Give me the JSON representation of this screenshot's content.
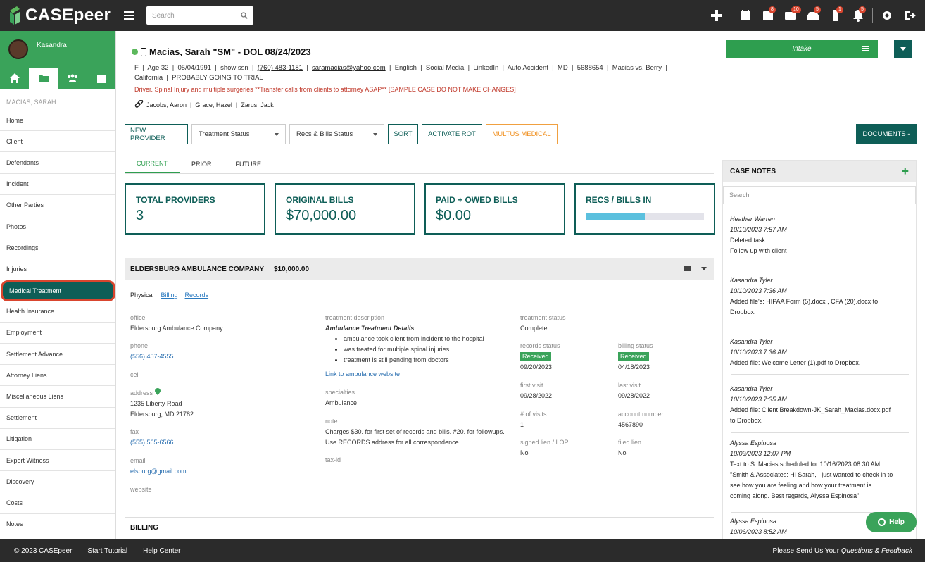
{
  "app": {
    "name": "CASEpeer",
    "brand_color": "#2e9e4f",
    "dark_color": "#0e5e57"
  },
  "header": {
    "search_placeholder": "Search",
    "badges": {
      "tasks": "8",
      "mail": "10",
      "inbox": "5",
      "phone": "1",
      "alerts": "5"
    }
  },
  "user": {
    "name": "Kasandra"
  },
  "sidebar": {
    "case_label": "MACIAS, SARAH",
    "items": [
      "Home",
      "Client",
      "Defendants",
      "Incident",
      "Other Parties",
      "Photos",
      "Recordings",
      "Injuries",
      "Medical Treatment",
      "Health Insurance",
      "Employment",
      "Settlement Advance",
      "Attorney Liens",
      "Miscellaneous Liens",
      "Settlement",
      "Litigation",
      "Expert Witness",
      "Discovery",
      "Costs",
      "Notes"
    ],
    "active": "Medical Treatment"
  },
  "case": {
    "title": "Macias, Sarah \"SM\" - DOL 08/24/2023",
    "line1": [
      "F",
      "Age 32",
      "05/04/1991",
      "show ssn"
    ],
    "phone": "(760) 483-1181",
    "email": "saramacias@yahoo.com",
    "line1b": [
      "English",
      "Social Media",
      "LinkedIn",
      "Auto Accident",
      "MD",
      "5688654",
      "Macias vs. Berry"
    ],
    "line2": [
      "California",
      "PROBABLY GOING TO TRIAL"
    ],
    "alert": "Driver. Spinal Injury and multiple surgeries **Transfer calls from clients to attorney ASAP** [SAMPLE CASE DO NOT MAKE CHANGES]",
    "contacts": [
      "Jacobs, Aaron",
      "Grace, Hazel",
      "Zarus, Jack"
    ],
    "stage": "Intake"
  },
  "toolbar": {
    "new_provider": "NEW PROVIDER",
    "treatment_status": "Treatment Status",
    "recs_bills_status": "Recs & Bills Status",
    "sort": "SORT",
    "activate_rot": "ACTIVATE ROT",
    "multus": "MULTUS MEDICAL",
    "documents": "DOCUMENTS -"
  },
  "tabs": [
    "CURRENT",
    "PRIOR",
    "FUTURE"
  ],
  "stats": {
    "total_providers": {
      "label": "TOTAL PROVIDERS",
      "value": "3"
    },
    "original_bills": {
      "label": "ORIGINAL BILLS",
      "value": "$70,000.00"
    },
    "paid_owed": {
      "label": "PAID + OWED BILLS",
      "value": "$0.00"
    },
    "recs_bills_in": {
      "label": "RECS / BILLS IN",
      "progress": 0.5
    }
  },
  "provider": {
    "name": "ELDERSBURG AMBULANCE COMPANY",
    "amount": "$10,000.00",
    "subtabs": {
      "physical": "Physical",
      "billing": "Billing",
      "records": "Records"
    },
    "office_label": "office",
    "office": "Eldersburg Ambulance Company",
    "phone_label": "phone",
    "phone": "(556) 457-4555",
    "cell_label": "cell",
    "address_label": "address",
    "address1": "1235 Liberty Road",
    "address2": "Eldersburg, MD 21782",
    "fax_label": "fax",
    "fax": "(555) 565-6566",
    "email_label": "email",
    "email": "elsburg@gmail.com",
    "website_label": "website",
    "desc_label": "treatment description",
    "desc_title": "Ambulance Treatment Details",
    "desc_items": [
      "ambulance took client from incident to the hospital",
      "was treated for multiple spinal injuries",
      "treatment is still pending from doctors"
    ],
    "desc_link": "Link to ambulance website",
    "specialties_label": "specialties",
    "specialties": "Ambulance",
    "note_label": "note",
    "note": "Charges $30. for first set of records and bills. #20. for followups. Use RECORDS address for all correspondence.",
    "taxid_label": "tax-id",
    "status_label": "treatment status",
    "status": "Complete",
    "records_label": "records status",
    "records_badge": "Received",
    "records_date": "09/20/2023",
    "billing_label": "billing status",
    "billing_badge": "Received",
    "billing_date": "04/18/2023",
    "first_visit_label": "first visit",
    "first_visit": "09/28/2022",
    "last_visit_label": "last visit",
    "last_visit": "09/28/2022",
    "visits_label": "# of visits",
    "visits": "1",
    "account_label": "account number",
    "account": "4567890",
    "lien_label": "signed lien / LOP",
    "lien": "No",
    "filed_label": "filed lien",
    "filed": "No"
  },
  "billing_header": "BILLING",
  "case_notes": {
    "title": "CASE NOTES",
    "search_placeholder": "Search",
    "notes": [
      {
        "who": "Heather Warren",
        "when": "10/10/2023 7:57 AM",
        "text1": "Deleted task:",
        "text2": "Follow up with client"
      },
      {
        "who": "Kasandra Tyler",
        "when": "10/10/2023 7:36 AM",
        "text1": "Added file's: HIPAA Form (5).docx , CFA (20).docx to",
        "text2": "Dropbox."
      },
      {
        "who": "Kasandra Tyler",
        "when": "10/10/2023 7:36 AM",
        "text1": "Added file: Welcome Letter (1).pdf to Dropbox.",
        "text2": ""
      },
      {
        "who": "Kasandra Tyler",
        "when": "10/10/2023 7:35 AM",
        "text1": "Added file: Client Breakdown-JK_Sarah_Macias.docx.pdf",
        "text2": "to Dropbox."
      },
      {
        "who": "Alyssa Espinosa",
        "when": "10/09/2023 12:07 PM",
        "text1": "Text to S. Macias scheduled for 10/16/2023 08:30 AM :",
        "text2": "\"Smith & Associates: Hi Sarah, I just wanted to check in to",
        "text3": "see how you are feeling and how your treatment is",
        "text4": "coming along. Best regards, Alyssa Espinosa\""
      },
      {
        "who": "Alyssa Espinosa",
        "when": "10/06/2023 8:52 AM",
        "text1": "",
        "text2": ""
      }
    ]
  },
  "help": "Help",
  "footer": {
    "copyright": "© 2023 CASEpeer",
    "tutorial": "Start Tutorial",
    "help_center": "Help Center",
    "feedback_prefix": "Please Send Us Your ",
    "feedback_link": "Questions & Feedback"
  }
}
